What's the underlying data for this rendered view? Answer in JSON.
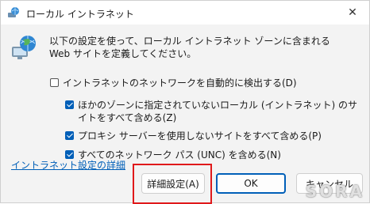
{
  "window": {
    "title": "ローカル イントラネット",
    "close_glyph": "✕",
    "title_icon": "globe-computer-icon"
  },
  "intro_text": "以下の設定を使って、ローカル イントラネット ゾーンに含まれる Web サイトを定義してください。",
  "options": {
    "auto_detect": {
      "label": "イントラネットのネットワークを自動的に検出する(D)",
      "checked": false
    },
    "other_sites": {
      "label": "ほかのゾーンに指定されていないローカル (イントラネット) のサイトをすべて含める(Z)",
      "checked": true
    },
    "bypass_proxy": {
      "label": "プロキシ サーバーを使用しないサイトをすべて含める(P)",
      "checked": true
    },
    "unc_paths": {
      "label": "すべてのネットワーク パス (UNC) を含める(N)",
      "checked": true
    }
  },
  "footer": {
    "help_link": "イントラネット設定の詳細",
    "advanced_button": "詳細設定(A)",
    "ok_button": "OK",
    "cancel_button": "キャンセル"
  },
  "colors": {
    "accent": "#005fb8",
    "highlight": "#e0191b"
  },
  "watermark": "SORA"
}
